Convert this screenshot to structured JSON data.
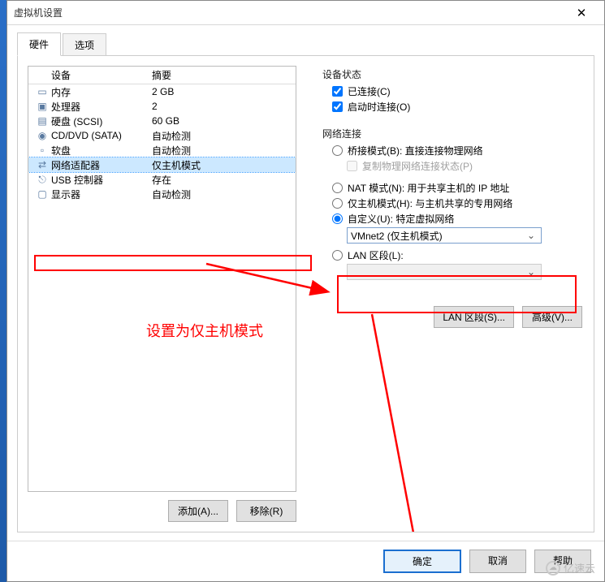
{
  "window": {
    "title": "虚拟机设置"
  },
  "tabs": {
    "hardware": "硬件",
    "options": "选项"
  },
  "list": {
    "header_device": "设备",
    "header_summary": "摘要",
    "rows": [
      {
        "icon": "memory-icon",
        "name": "内存",
        "summary": "2 GB"
      },
      {
        "icon": "cpu-icon",
        "name": "处理器",
        "summary": "2"
      },
      {
        "icon": "disk-icon",
        "name": "硬盘 (SCSI)",
        "summary": "60 GB"
      },
      {
        "icon": "cd-icon",
        "name": "CD/DVD (SATA)",
        "summary": "自动检测"
      },
      {
        "icon": "floppy-icon",
        "name": "软盘",
        "summary": "自动检测"
      },
      {
        "icon": "network-icon",
        "name": "网络适配器",
        "summary": "仅主机模式"
      },
      {
        "icon": "usb-icon",
        "name": "USB 控制器",
        "summary": "存在"
      },
      {
        "icon": "display-icon",
        "name": "显示器",
        "summary": "自动检测"
      }
    ]
  },
  "list_buttons": {
    "add": "添加(A)...",
    "remove": "移除(R)"
  },
  "right": {
    "device_status_title": "设备状态",
    "connected": "已连接(C)",
    "connect_at_poweron": "启动时连接(O)",
    "net_title": "网络连接",
    "bridged": "桥接模式(B): 直接连接物理网络",
    "replicate": "复制物理网络连接状态(P)",
    "nat": "NAT 模式(N): 用于共享主机的 IP 地址",
    "hostonly": "仅主机模式(H): 与主机共享的专用网络",
    "custom": "自定义(U): 特定虚拟网络",
    "vmnet_value": "VMnet2 (仅主机模式)",
    "lanseg": "LAN 区段(L):",
    "lan_button": "LAN 区段(S)...",
    "advanced": "高级(V)..."
  },
  "footer": {
    "ok": "确定",
    "cancel": "取消",
    "help": "帮助"
  },
  "annotation": {
    "text": "设置为仅主机模式"
  },
  "watermark": "亿速云"
}
